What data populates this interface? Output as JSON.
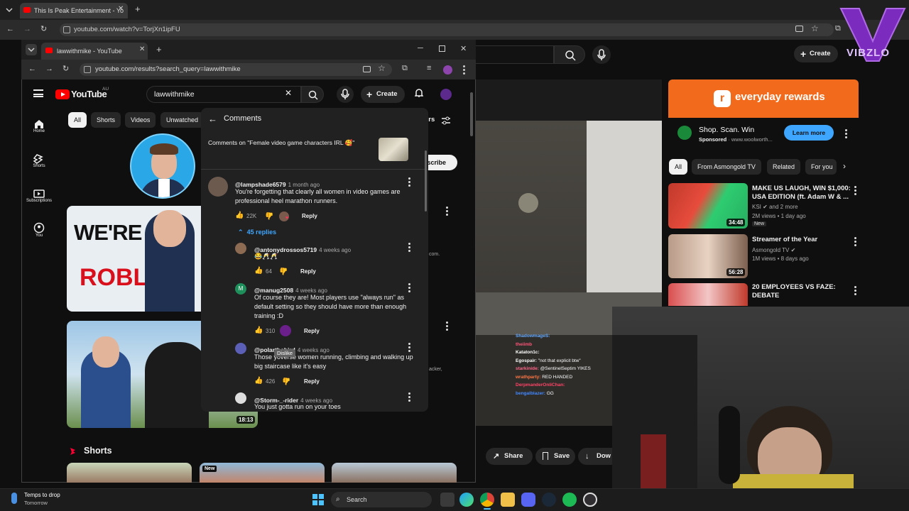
{
  "back_browser": {
    "tab_title": "This Is Peak Entertainment - Yo",
    "url": "youtube.com/watch?v=TorjXn1ipFU",
    "create_label": "Create",
    "ad": {
      "banner_text": "everyday rewards",
      "headline": "Shop. Scan. Win",
      "sponsored": "Sponsored",
      "domain": "www.woolworth...",
      "cta": "Learn more"
    },
    "chips": [
      "All",
      "From Asmongold TV",
      "Related",
      "For you"
    ],
    "suggestions": [
      {
        "title": "MAKE US LAUGH, WIN $1,000: USA EDITION (ft. Adam W & ...",
        "channel": "KSI",
        "channel_extra": "and 2 more",
        "meta": "2M views • 1 day ago",
        "badge": "New",
        "duration": "34:48"
      },
      {
        "title": "Streamer of the Year",
        "channel": "Asmongold TV",
        "meta": "1M views • 8 days ago",
        "duration": "56:28"
      },
      {
        "title": "20 EMPLOYEES VS FAZE: DEBATE",
        "channel": "",
        "meta": ""
      }
    ],
    "actions": {
      "share": "Share",
      "save": "Save",
      "download": "Dow"
    },
    "chat": [
      {
        "name": "ShadowmageS:",
        "text": ""
      },
      {
        "name": "theiimb",
        "text": ""
      },
      {
        "name": "Kataton1c:",
        "text": ""
      },
      {
        "name": "Egospair:",
        "text": "\"not that explicit btw\""
      },
      {
        "name": "starkinide:",
        "text": "@SentinelSeptim YIKES"
      },
      {
        "name": "wrathparty:",
        "text": "RED HANDED"
      },
      {
        "name": "DerpmanderOnliChan:",
        "text": ""
      },
      {
        "name": "bengalblazer:",
        "text": "GG"
      }
    ]
  },
  "front_browser": {
    "tab_title": "lawwithmike - YouTube",
    "url": "youtube.com/results?search_query=lawwithmike",
    "youtube_logo": "YouTube",
    "region": "AU",
    "search_value": "lawwithmike",
    "create_label": "Create",
    "sidebar": [
      {
        "label": "Home",
        "icon": "home-icon"
      },
      {
        "label": "Shorts",
        "icon": "shorts-icon"
      },
      {
        "label": "Subscriptions",
        "icon": "subscriptions-icon"
      },
      {
        "label": "You",
        "icon": "you-icon"
      }
    ],
    "filters": [
      "All",
      "Shorts",
      "Videos",
      "Unwatched"
    ],
    "filters_label": "ers",
    "subscribe_label": "bscribe",
    "thumb1_text_top": "WE'RE S",
    "thumb1_text_bottom": "ROBLE",
    "video2_duration": "18:13",
    "side_text_1": "com.",
    "side_text_2": "acker,",
    "shorts_header": "Shorts",
    "shorts_new_badge": "New"
  },
  "comments_panel": {
    "header": "Comments",
    "context": "Comments on \"Female video game characters IRL 🥰\"",
    "replies_label": "45 replies",
    "reply_label": "Reply",
    "tooltip": "Dislike",
    "comments": [
      {
        "author": "@lampshade6579",
        "time": "1 month ago",
        "text": "You're forgetting that clearly all women in video games are professional heel marathon runners.",
        "likes": "22K"
      },
      {
        "author": "@antonydrossos5719",
        "time": "4 weeks ago",
        "text": "😂🥂🥂",
        "likes": "64"
      },
      {
        "author": "@manug2508",
        "time": "4 weeks ago",
        "text": "Of course they are! Most players use \"always run\" as default setting so they should have more than enough training :D",
        "likes": "310"
      },
      {
        "author": "@polarthebird",
        "time": "4 weeks ago",
        "text": "Those yoverse women running, climbing and walking up big staircase like it's easy",
        "likes": "426"
      },
      {
        "author": "@Storm-_-rider",
        "time": "4 weeks ago",
        "text": "You just gotta run on your toes",
        "likes": ""
      }
    ]
  },
  "taskbar": {
    "weather_line1": "Temps to drop",
    "weather_line2": "Tomorrow",
    "search_placeholder": "Search"
  },
  "overlay": {
    "logo_text": "VIBZLO"
  },
  "colors": {
    "yt_red": "#ff0000",
    "link_blue": "#3ea6ff",
    "ad_orange": "#f26a1b",
    "panel": "#212121"
  }
}
